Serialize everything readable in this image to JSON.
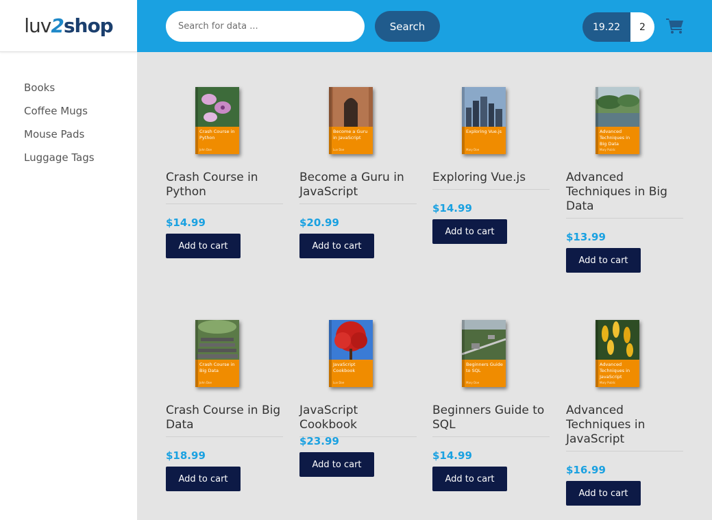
{
  "brand": {
    "logo_part1": "luv",
    "logo_part2": "2",
    "logo_part3": "shop"
  },
  "sidebar": {
    "categories": [
      "Books",
      "Coffee Mugs",
      "Mouse Pads",
      "Luggage Tags"
    ]
  },
  "search": {
    "placeholder": "Search for data ...",
    "value": "",
    "button_label": "Search"
  },
  "cart": {
    "total": "19.22",
    "quantity": "2",
    "icon": "shopping-cart-icon"
  },
  "colors": {
    "header": "#1aa1e1",
    "button_dark": "#205b8c",
    "add_button": "#0d1a46",
    "price": "#1aa1e1",
    "cover": "#f08c00"
  },
  "products": [
    {
      "name": "Crash Course in Python",
      "cover_title": "Crash Course in Python",
      "cover_author": "John Doe",
      "price": "$14.99",
      "button": "Add to cart",
      "cover_icon": "orchid-flower-photo"
    },
    {
      "name": "Become a Guru in JavaScript",
      "cover_title": "Become a Guru in JavaScript",
      "cover_author": "Luv Doe",
      "price": "$20.99",
      "button": "Add to cart",
      "cover_icon": "stone-archway-photo"
    },
    {
      "name": "Exploring Vue.js",
      "cover_title": "Exploring Vue.js",
      "cover_author": "Mary Doe",
      "price": "$14.99",
      "button": "Add to cart",
      "cover_icon": "city-skyline-photo"
    },
    {
      "name": "Advanced Techniques in Big Data",
      "cover_title": "Advanced Techniques in Big Data",
      "cover_author": "Mary Public",
      "price": "$13.99",
      "button": "Add to cart",
      "cover_icon": "river-landscape-photo"
    },
    {
      "name": "Crash Course in Big Data",
      "cover_title": "Crash Course in Big Data",
      "cover_author": "John Doe",
      "price": "$18.99",
      "button": "Add to cart",
      "cover_icon": "forest-steps-photo"
    },
    {
      "name": "JavaScript Cookbook",
      "cover_title": "JavaScript Cookbook",
      "cover_author": "Luv Doe",
      "price": "$23.99",
      "button": "Add to cart",
      "cover_icon": "red-tree-photo"
    },
    {
      "name": "Beginners Guide to SQL",
      "cover_title": "Beginners Guide to SQL",
      "cover_author": "Mary Doe",
      "price": "$14.99",
      "button": "Add to cart",
      "cover_icon": "aerial-city-photo"
    },
    {
      "name": "Advanced Techniques in JavaScript",
      "cover_title": "Advanced Techniques in JavaScript",
      "cover_author": "Mary Public",
      "price": "$16.99",
      "button": "Add to cart",
      "cover_icon": "yellow-flowers-photo"
    }
  ]
}
